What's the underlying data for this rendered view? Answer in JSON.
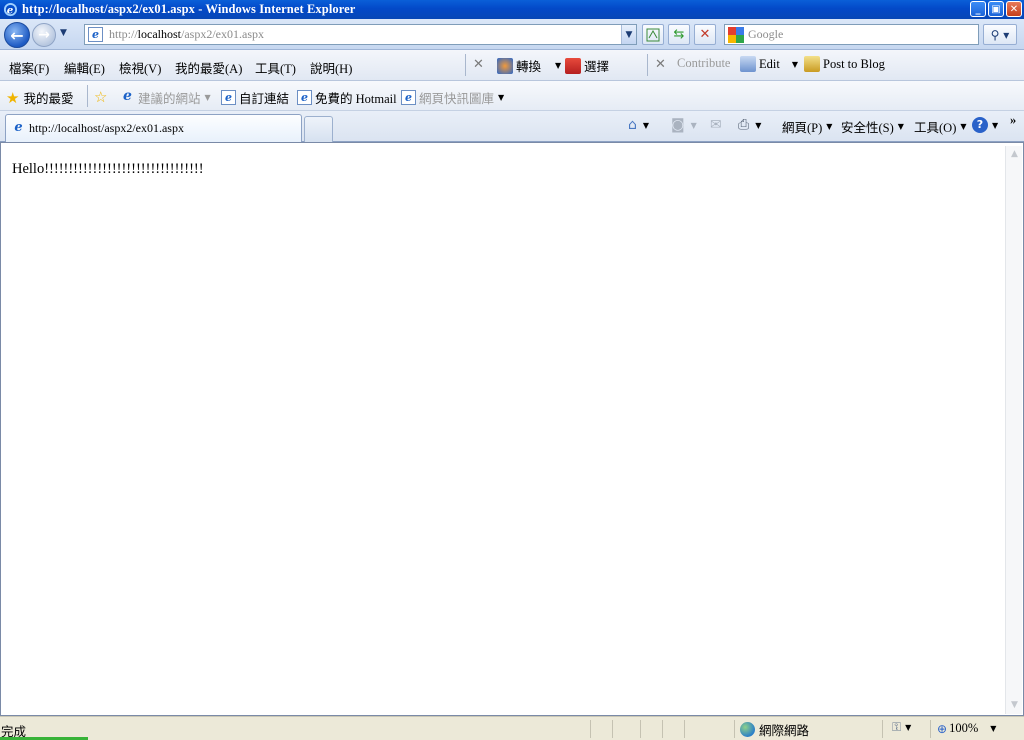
{
  "window": {
    "title": "http://localhost/aspx2/ex01.aspx - Windows Internet Explorer",
    "minimize": "_",
    "maximize": "▣",
    "close": "✕"
  },
  "address_bar": {
    "url_prefix": "http://",
    "url_host": "localhost",
    "url_path": "/aspx2/ex01.aspx",
    "search_placeholder": "Google"
  },
  "menu": {
    "items": [
      "檔案(F)",
      "編輯(E)",
      "檢視(V)",
      "我的最愛(A)",
      "工具(T)",
      "說明(H)"
    ],
    "translate_label": "轉換",
    "select_label": "選擇",
    "contribute_label": "Contribute",
    "edit_label": "Edit",
    "post_label": "Post to Blog"
  },
  "favorites_bar": {
    "favorites_label": "我的最愛",
    "items": [
      "建議的網站",
      "自訂連結",
      "免費的 Hotmail",
      "網頁快訊圖庫"
    ]
  },
  "tabs": {
    "active_title": "http://localhost/aspx2/ex01.aspx"
  },
  "command_bar": {
    "page_label": "網頁(P)",
    "safety_label": "安全性(S)",
    "tools_label": "工具(O)",
    "more": "»"
  },
  "page": {
    "body_text": "Hello!!!!!!!!!!!!!!!!!!!!!!!!!!!!!!!!!"
  },
  "status_bar": {
    "status_text": "完成",
    "zone_label": "網際網路",
    "zoom_label": "100%"
  },
  "colors": {
    "title_bar": "#0349c8",
    "content_bg": "#ffffff",
    "status_bg": "#ece9d8"
  }
}
